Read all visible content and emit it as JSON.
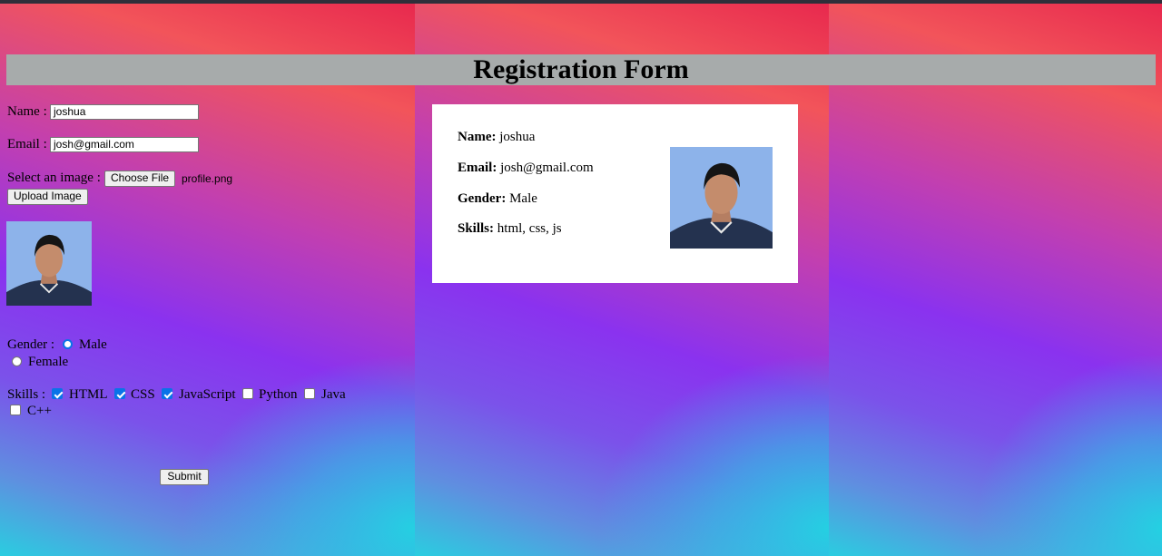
{
  "page": {
    "title": "Registration Form"
  },
  "form": {
    "name_label": "Name :",
    "name_value": "joshua",
    "email_label": "Email :",
    "email_value": "josh@gmail.com",
    "image_label": "Select an image :",
    "choose_file_label": "Choose File",
    "file_name": "profile.png",
    "upload_label": "Upload Image",
    "gender_label": "Gender :",
    "gender_options": [
      {
        "label": "Male",
        "selected": true
      },
      {
        "label": "Female",
        "selected": false
      }
    ],
    "skills_label": "Skills :",
    "skills": [
      {
        "label": "HTML",
        "checked": true
      },
      {
        "label": "CSS",
        "checked": true
      },
      {
        "label": "JavaScript",
        "checked": true
      },
      {
        "label": "Python",
        "checked": false
      },
      {
        "label": "Java",
        "checked": false
      },
      {
        "label": "C++",
        "checked": false
      }
    ],
    "submit_label": "Submit"
  },
  "card": {
    "name_key": "Name:",
    "name_value": "joshua",
    "email_key": "Email:",
    "email_value": "josh@gmail.com",
    "gender_key": "Gender:",
    "gender_value": "Male",
    "skills_key": "Skills:",
    "skills_value": "html, css, js"
  },
  "colors": {
    "accent": "#0a73e8",
    "title_bar": "#a7abab",
    "gradient_top": "#e8294e",
    "gradient_mid": "#8a32ef",
    "gradient_bottom": "#2acde0"
  }
}
